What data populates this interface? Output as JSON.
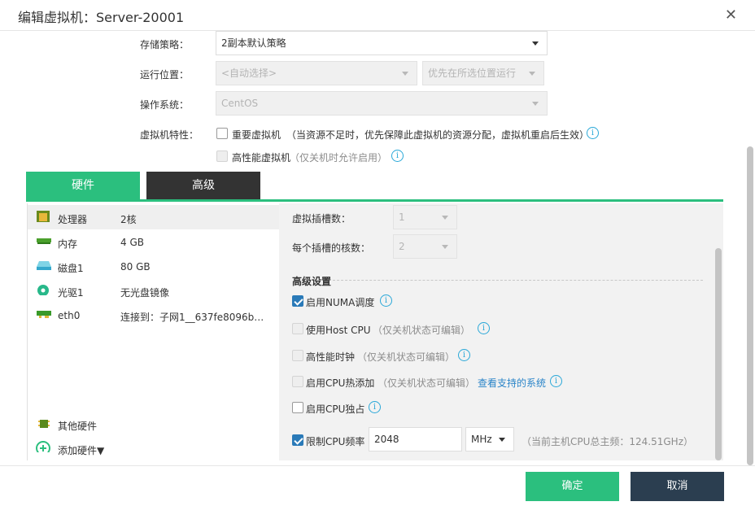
{
  "dialog": {
    "title": "编辑虚拟机：Server-20001"
  },
  "form": {
    "storage_label": "存储策略：",
    "storage_value": "2副本默认策略",
    "location_label": "运行位置：",
    "location_value": "<自动选择>",
    "location_mode": "优先在所选位置运行",
    "os_label": "操作系统：",
    "os_value": "CentOS",
    "feature_label": "虚拟机特性：",
    "important_vm": "重要虚拟机",
    "important_note": "（当资源不足时，优先保障此虚拟机的资源分配，虚拟机重启后生效）",
    "hp_vm": "高性能虚拟机",
    "hp_note": "（仅关机时允许启用）"
  },
  "tabs": [
    {
      "label": "硬件"
    },
    {
      "label": "高级"
    }
  ],
  "hardware": {
    "items": [
      {
        "name": "处理器",
        "value": "2核",
        "icon": "cpu-icon"
      },
      {
        "name": "内存",
        "value": "4 GB",
        "icon": "memory-icon"
      },
      {
        "name": "磁盘1",
        "value": "80 GB",
        "icon": "disk-icon"
      },
      {
        "name": "光驱1",
        "value": "无光盘镜像",
        "icon": "cdrom-icon"
      },
      {
        "name": "eth0",
        "value": "连接到：子网1__637fe8096b…",
        "icon": "nic-icon"
      }
    ],
    "other": "其他硬件",
    "add": "添加硬件▼"
  },
  "cpu": {
    "sockets_label": "虚拟插槽数：",
    "sockets_value": "1",
    "cores_label": "每个插槽的核数：",
    "cores_value": "2",
    "advanced_title": "高级设置",
    "numa": "启用NUMA调度",
    "host_cpu": "使用Host CPU",
    "host_cpu_note": "（仅关机状态可编辑）",
    "hp_clock": "高性能时钟",
    "hp_clock_note": "（仅关机状态可编辑）",
    "hotplug": "启用CPU热添加",
    "hotplug_note": "（仅关机状态可编辑）",
    "hotplug_link": "查看支持的系统",
    "exclusive": "启用CPU独占",
    "limit": "限制CPU频率",
    "limit_value": "2048",
    "limit_unit": "MHz",
    "limit_note": "（当前主机CPU总主频：124.51GHz）"
  },
  "buttons": {
    "ok": "确定",
    "cancel": "取消"
  },
  "colors": {
    "accent": "#2bbf7e",
    "dark": "#333333",
    "cancel": "#2b3e50",
    "checkbox": "#2a7ab8",
    "info": "#2aa8d8"
  }
}
